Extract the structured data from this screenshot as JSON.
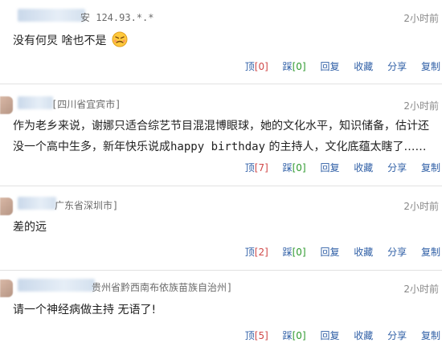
{
  "comments": [
    {
      "location": "安 124.93.*.*",
      "time": "2小时前",
      "text_a": "没有何炅 啥也不是",
      "emoji": "angry-face-emoji",
      "actions": {
        "up_label": "顶",
        "up_count": "[0]",
        "down_label": "踩",
        "down_count": "[0]",
        "reply": "回复",
        "fav": "收藏",
        "share": "分享",
        "copy": "复制"
      }
    },
    {
      "location": "[四川省宜宾市]",
      "time": "2小时前",
      "text_a": "作为老乡来说，谢娜只适合综艺节目混混博眼球，她的文化水平，知识储备，估计还没一个高中生多，新年快乐说成",
      "text_b": "happy birthday",
      "text_c": " 的主持人，文化底蕴太瞎了……",
      "actions": {
        "up_label": "顶",
        "up_count": "[7]",
        "down_label": "踩",
        "down_count": "[0]",
        "reply": "回复",
        "fav": "收藏",
        "share": "分享",
        "copy": "复制"
      }
    },
    {
      "location": "广东省深圳市]",
      "time": "2小时前",
      "text_a": "差的远",
      "actions": {
        "up_label": "顶",
        "up_count": "[2]",
        "down_label": "踩",
        "down_count": "[0]",
        "reply": "回复",
        "fav": "收藏",
        "share": "分享",
        "copy": "复制"
      }
    },
    {
      "location": "贵州省黔西南布依族苗族自治州]",
      "time": "2小时前",
      "text_a": "请一个神经病做主持 无语了!",
      "actions": {
        "up_label": "顶",
        "up_count": "[5]",
        "down_label": "踩",
        "down_count": "[0]",
        "reply": "回复",
        "fav": "收藏",
        "share": "分享",
        "copy": "复制"
      }
    }
  ],
  "colors": {
    "link": "#2f5fa6",
    "count_positive": "#2f9a2f",
    "count_up": "#d04848"
  }
}
